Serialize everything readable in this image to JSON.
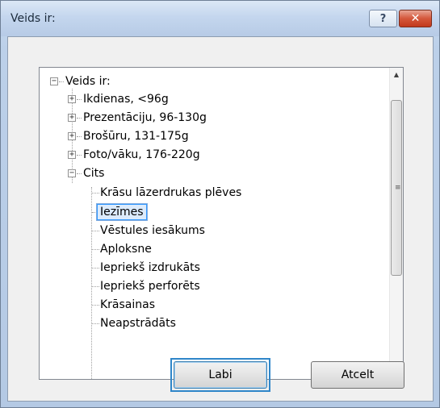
{
  "window": {
    "title": "Veids ir:",
    "help_label": "?",
    "close_label": "✕"
  },
  "tree": {
    "root": {
      "label": "Veids ir:",
      "expander": "−"
    },
    "groups": [
      {
        "label": "Ikdienas, <96g",
        "expander": "+"
      },
      {
        "label": "Prezentāciju, 96-130g",
        "expander": "+"
      },
      {
        "label": "Brošūru, 131-175g",
        "expander": "+"
      },
      {
        "label": "Foto/vāku, 176-220g",
        "expander": "+"
      },
      {
        "label": "Cits",
        "expander": "−"
      }
    ],
    "cits_items": [
      {
        "label": "Krāsu lāzerdrukas plēves"
      },
      {
        "label": "Iezīmes",
        "selected": true
      },
      {
        "label": "Vēstules iesākums"
      },
      {
        "label": "Aploksne"
      },
      {
        "label": "Iepriekš izdrukāts"
      },
      {
        "label": "Iepriekš perforēts"
      },
      {
        "label": "Krāsainas"
      },
      {
        "label": "Neapstrādāts"
      }
    ]
  },
  "scrollbar": {
    "up_arrow": "▲",
    "down_arrow": "▼",
    "grip": "≡"
  },
  "buttons": {
    "ok": "Labi",
    "cancel": "Atcelt"
  }
}
